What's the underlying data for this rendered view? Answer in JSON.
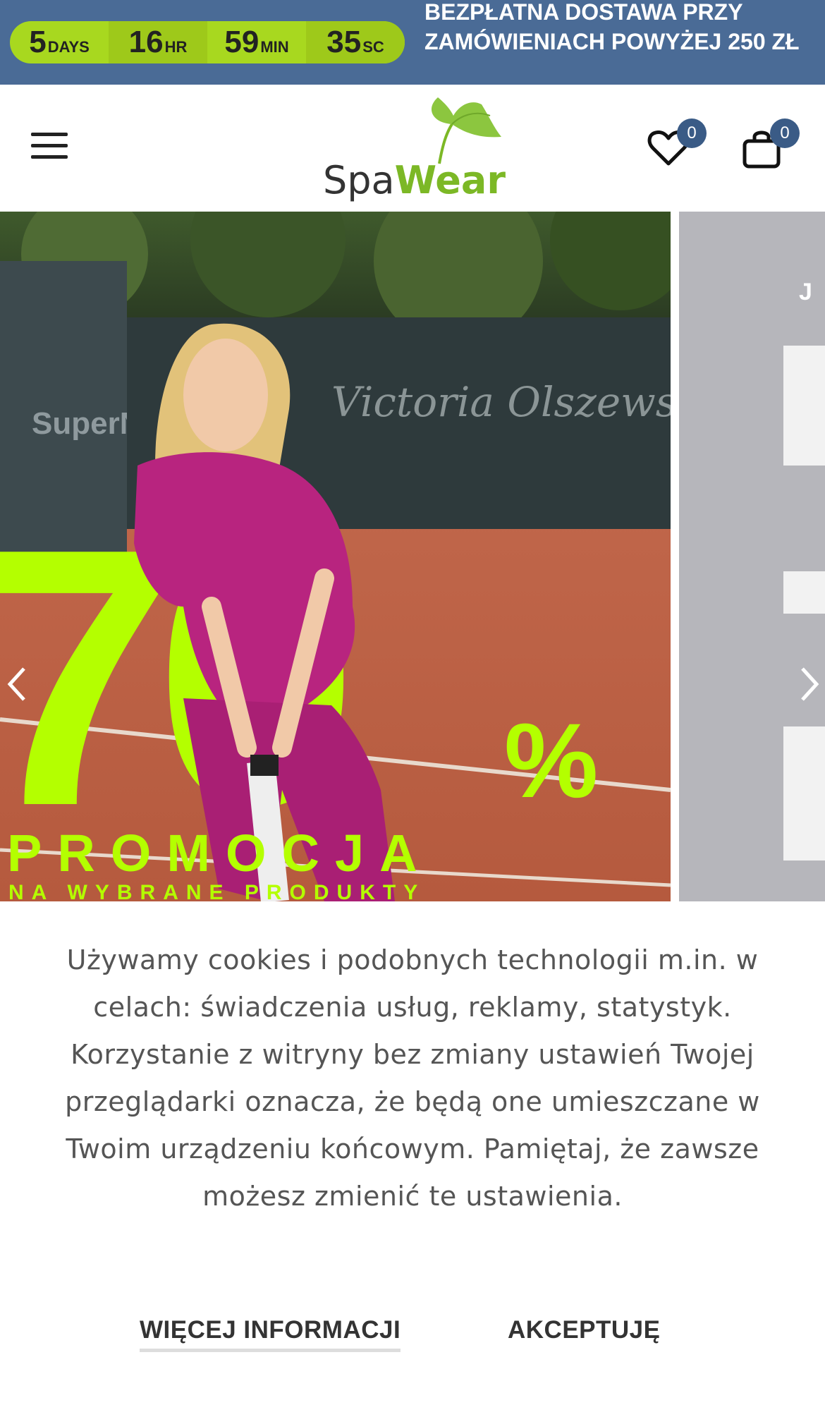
{
  "topbar": {
    "countdown": [
      {
        "num": "5",
        "unit": "DAYS"
      },
      {
        "num": "16",
        "unit": "HR"
      },
      {
        "num": "59",
        "unit": "MIN"
      },
      {
        "num": "35",
        "unit": "SC"
      }
    ],
    "free_shipping": "BEZPŁATNA DOSTAWA PRZY ZAMÓWIENIACH POWYŻEJ 250 ZŁ",
    "bar_color": "#4a6b96",
    "countdown_color": "#a8d81f"
  },
  "header": {
    "logo": {
      "part1": "Spa",
      "part2": "Wear"
    },
    "wishlist_count": "0",
    "cart_count": "0",
    "icons": [
      "menu-icon",
      "heart-icon",
      "bag-icon"
    ]
  },
  "hero": {
    "big_number": "70",
    "percent": "%",
    "promo_title": "PROMOCJA",
    "promo_subtitle": "NA WYBRANE PRODUKTY",
    "banner_text": "Victoria Olszewska TEAM",
    "sponsor_text": "SuperNet",
    "next_slide_letter": "J",
    "accent_color": "#b4ff00",
    "shirt_color": "#b8247f"
  },
  "cookie": {
    "text": "Używamy cookies i podobnych technologii m.in. w celach: świadczenia usług, reklamy, statystyk. Korzystanie z witryny bez zmiany ustawień Twojej przeglądarki oznacza, że będą one umieszczane w Twoim urządzeniu końcowym. Pamiętaj, że zawsze możesz zmienić te ustawienia.",
    "more_label": "WIĘCEJ INFORMACJI",
    "accept_label": "AKCEPTUJĘ"
  }
}
